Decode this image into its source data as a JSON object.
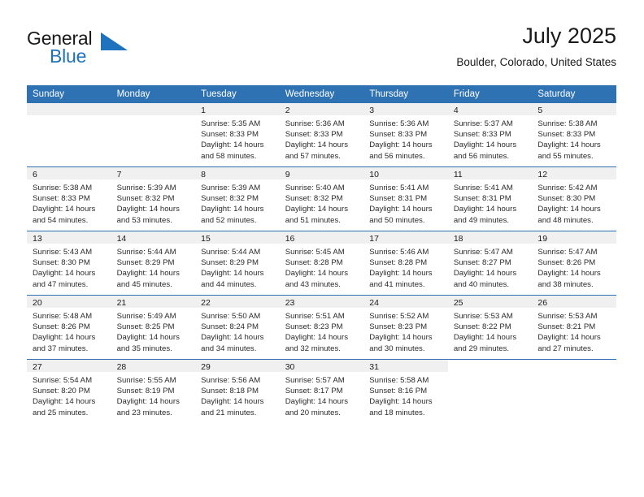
{
  "brand": {
    "name_part1": "General",
    "name_part2": "Blue",
    "logo_icon": "triangle-logo-icon"
  },
  "header": {
    "title": "July 2025",
    "location": "Boulder, Colorado, United States"
  },
  "colors": {
    "header_blue": "#2f72b4",
    "brand_blue": "#1f72bd",
    "date_band_gray": "#f0f0f0",
    "text": "#1a1a1a"
  },
  "weekday_headers": [
    "Sunday",
    "Monday",
    "Tuesday",
    "Wednesday",
    "Thursday",
    "Friday",
    "Saturday"
  ],
  "labels": {
    "sunrise": "Sunrise:",
    "sunset": "Sunset:",
    "daylight": "Daylight:"
  },
  "weeks": [
    [
      {
        "date": "",
        "lines": []
      },
      {
        "date": "",
        "lines": []
      },
      {
        "date": "1",
        "lines": [
          "Sunrise: 5:35 AM",
          "Sunset: 8:33 PM",
          "Daylight: 14 hours",
          "and 58 minutes."
        ]
      },
      {
        "date": "2",
        "lines": [
          "Sunrise: 5:36 AM",
          "Sunset: 8:33 PM",
          "Daylight: 14 hours",
          "and 57 minutes."
        ]
      },
      {
        "date": "3",
        "lines": [
          "Sunrise: 5:36 AM",
          "Sunset: 8:33 PM",
          "Daylight: 14 hours",
          "and 56 minutes."
        ]
      },
      {
        "date": "4",
        "lines": [
          "Sunrise: 5:37 AM",
          "Sunset: 8:33 PM",
          "Daylight: 14 hours",
          "and 56 minutes."
        ]
      },
      {
        "date": "5",
        "lines": [
          "Sunrise: 5:38 AM",
          "Sunset: 8:33 PM",
          "Daylight: 14 hours",
          "and 55 minutes."
        ]
      }
    ],
    [
      {
        "date": "6",
        "lines": [
          "Sunrise: 5:38 AM",
          "Sunset: 8:33 PM",
          "Daylight: 14 hours",
          "and 54 minutes."
        ]
      },
      {
        "date": "7",
        "lines": [
          "Sunrise: 5:39 AM",
          "Sunset: 8:32 PM",
          "Daylight: 14 hours",
          "and 53 minutes."
        ]
      },
      {
        "date": "8",
        "lines": [
          "Sunrise: 5:39 AM",
          "Sunset: 8:32 PM",
          "Daylight: 14 hours",
          "and 52 minutes."
        ]
      },
      {
        "date": "9",
        "lines": [
          "Sunrise: 5:40 AM",
          "Sunset: 8:32 PM",
          "Daylight: 14 hours",
          "and 51 minutes."
        ]
      },
      {
        "date": "10",
        "lines": [
          "Sunrise: 5:41 AM",
          "Sunset: 8:31 PM",
          "Daylight: 14 hours",
          "and 50 minutes."
        ]
      },
      {
        "date": "11",
        "lines": [
          "Sunrise: 5:41 AM",
          "Sunset: 8:31 PM",
          "Daylight: 14 hours",
          "and 49 minutes."
        ]
      },
      {
        "date": "12",
        "lines": [
          "Sunrise: 5:42 AM",
          "Sunset: 8:30 PM",
          "Daylight: 14 hours",
          "and 48 minutes."
        ]
      }
    ],
    [
      {
        "date": "13",
        "lines": [
          "Sunrise: 5:43 AM",
          "Sunset: 8:30 PM",
          "Daylight: 14 hours",
          "and 47 minutes."
        ]
      },
      {
        "date": "14",
        "lines": [
          "Sunrise: 5:44 AM",
          "Sunset: 8:29 PM",
          "Daylight: 14 hours",
          "and 45 minutes."
        ]
      },
      {
        "date": "15",
        "lines": [
          "Sunrise: 5:44 AM",
          "Sunset: 8:29 PM",
          "Daylight: 14 hours",
          "and 44 minutes."
        ]
      },
      {
        "date": "16",
        "lines": [
          "Sunrise: 5:45 AM",
          "Sunset: 8:28 PM",
          "Daylight: 14 hours",
          "and 43 minutes."
        ]
      },
      {
        "date": "17",
        "lines": [
          "Sunrise: 5:46 AM",
          "Sunset: 8:28 PM",
          "Daylight: 14 hours",
          "and 41 minutes."
        ]
      },
      {
        "date": "18",
        "lines": [
          "Sunrise: 5:47 AM",
          "Sunset: 8:27 PM",
          "Daylight: 14 hours",
          "and 40 minutes."
        ]
      },
      {
        "date": "19",
        "lines": [
          "Sunrise: 5:47 AM",
          "Sunset: 8:26 PM",
          "Daylight: 14 hours",
          "and 38 minutes."
        ]
      }
    ],
    [
      {
        "date": "20",
        "lines": [
          "Sunrise: 5:48 AM",
          "Sunset: 8:26 PM",
          "Daylight: 14 hours",
          "and 37 minutes."
        ]
      },
      {
        "date": "21",
        "lines": [
          "Sunrise: 5:49 AM",
          "Sunset: 8:25 PM",
          "Daylight: 14 hours",
          "and 35 minutes."
        ]
      },
      {
        "date": "22",
        "lines": [
          "Sunrise: 5:50 AM",
          "Sunset: 8:24 PM",
          "Daylight: 14 hours",
          "and 34 minutes."
        ]
      },
      {
        "date": "23",
        "lines": [
          "Sunrise: 5:51 AM",
          "Sunset: 8:23 PM",
          "Daylight: 14 hours",
          "and 32 minutes."
        ]
      },
      {
        "date": "24",
        "lines": [
          "Sunrise: 5:52 AM",
          "Sunset: 8:23 PM",
          "Daylight: 14 hours",
          "and 30 minutes."
        ]
      },
      {
        "date": "25",
        "lines": [
          "Sunrise: 5:53 AM",
          "Sunset: 8:22 PM",
          "Daylight: 14 hours",
          "and 29 minutes."
        ]
      },
      {
        "date": "26",
        "lines": [
          "Sunrise: 5:53 AM",
          "Sunset: 8:21 PM",
          "Daylight: 14 hours",
          "and 27 minutes."
        ]
      }
    ],
    [
      {
        "date": "27",
        "lines": [
          "Sunrise: 5:54 AM",
          "Sunset: 8:20 PM",
          "Daylight: 14 hours",
          "and 25 minutes."
        ]
      },
      {
        "date": "28",
        "lines": [
          "Sunrise: 5:55 AM",
          "Sunset: 8:19 PM",
          "Daylight: 14 hours",
          "and 23 minutes."
        ]
      },
      {
        "date": "29",
        "lines": [
          "Sunrise: 5:56 AM",
          "Sunset: 8:18 PM",
          "Daylight: 14 hours",
          "and 21 minutes."
        ]
      },
      {
        "date": "30",
        "lines": [
          "Sunrise: 5:57 AM",
          "Sunset: 8:17 PM",
          "Daylight: 14 hours",
          "and 20 minutes."
        ]
      },
      {
        "date": "31",
        "lines": [
          "Sunrise: 5:58 AM",
          "Sunset: 8:16 PM",
          "Daylight: 14 hours",
          "and 18 minutes."
        ]
      },
      {
        "date": "",
        "lines": []
      },
      {
        "date": "",
        "lines": []
      }
    ]
  ]
}
